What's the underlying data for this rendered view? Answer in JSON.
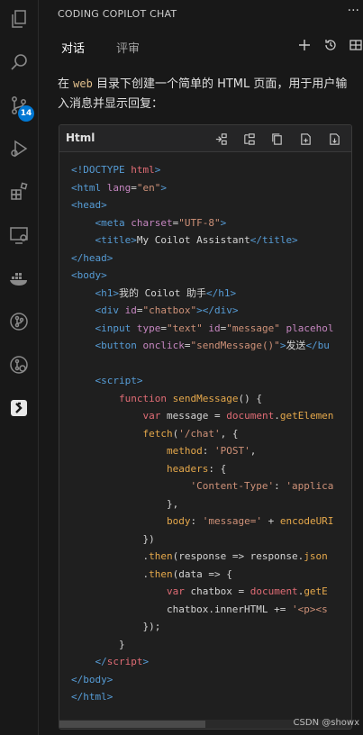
{
  "panel": {
    "title": "CODING COPILOT CHAT",
    "more": "···",
    "tabs": [
      {
        "label": "对话"
      },
      {
        "label": "评审"
      }
    ]
  },
  "activity": {
    "source_control_badge": "14"
  },
  "prompt": {
    "before": "在 ",
    "keyword": "web",
    "after": " 目录下创建一个简单的 HTML 页面，用于用户输入消息并显示回复："
  },
  "code_block": {
    "language": "Html",
    "lines": [
      [
        [
          "t-tag",
          "<!DOCTYPE "
        ],
        [
          "t-tagname",
          "html"
        ],
        [
          "t-tag",
          ">"
        ]
      ],
      [
        [
          "t-tag",
          "<html "
        ],
        [
          "t-attr",
          "lang"
        ],
        [
          "t-plain",
          "="
        ],
        [
          "t-str",
          "\"en\""
        ],
        [
          "t-tag",
          ">"
        ]
      ],
      [
        [
          "t-tag",
          "<head>"
        ]
      ],
      [
        [
          "t-plain",
          "    "
        ],
        [
          "t-tag",
          "<meta "
        ],
        [
          "t-attr",
          "charset"
        ],
        [
          "t-plain",
          "="
        ],
        [
          "t-str",
          "\"UTF-8\""
        ],
        [
          "t-tag",
          ">"
        ]
      ],
      [
        [
          "t-plain",
          "    "
        ],
        [
          "t-tag",
          "<title>"
        ],
        [
          "t-text",
          "My Coilot Assistant"
        ],
        [
          "t-tag",
          "</title>"
        ]
      ],
      [
        [
          "t-tag",
          "</head>"
        ]
      ],
      [
        [
          "t-tag",
          "<body>"
        ]
      ],
      [
        [
          "t-plain",
          "    "
        ],
        [
          "t-tag",
          "<h1>"
        ],
        [
          "t-text",
          "我的 Coilot 助手"
        ],
        [
          "t-tag",
          "</h1>"
        ]
      ],
      [
        [
          "t-plain",
          "    "
        ],
        [
          "t-tag",
          "<div "
        ],
        [
          "t-attr",
          "id"
        ],
        [
          "t-plain",
          "="
        ],
        [
          "t-str",
          "\"chatbox\""
        ],
        [
          "t-tag",
          "></div>"
        ]
      ],
      [
        [
          "t-plain",
          "    "
        ],
        [
          "t-tag",
          "<input "
        ],
        [
          "t-attr",
          "type"
        ],
        [
          "t-plain",
          "="
        ],
        [
          "t-str",
          "\"text\""
        ],
        [
          "t-plain",
          " "
        ],
        [
          "t-attr",
          "id"
        ],
        [
          "t-plain",
          "="
        ],
        [
          "t-str",
          "\"message\""
        ],
        [
          "t-plain",
          " "
        ],
        [
          "t-attr",
          "placehol"
        ]
      ],
      [
        [
          "t-plain",
          "    "
        ],
        [
          "t-tag",
          "<button "
        ],
        [
          "t-attr",
          "onclick"
        ],
        [
          "t-plain",
          "="
        ],
        [
          "t-str",
          "\"sendMessage()\""
        ],
        [
          "t-tag",
          ">"
        ],
        [
          "t-text",
          "发送"
        ],
        [
          "t-tag",
          "</bu"
        ]
      ],
      [
        [
          "t-plain",
          ""
        ]
      ],
      [
        [
          "t-plain",
          "    "
        ],
        [
          "t-tag",
          "<script>"
        ]
      ],
      [
        [
          "t-plain",
          "        "
        ],
        [
          "t-kw",
          "function "
        ],
        [
          "t-fn",
          "sendMessage"
        ],
        [
          "t-plain",
          "() {"
        ]
      ],
      [
        [
          "t-plain",
          "            "
        ],
        [
          "t-kw",
          "var "
        ],
        [
          "t-plain",
          "message = "
        ],
        [
          "t-obj",
          "document"
        ],
        [
          "t-plain",
          "."
        ],
        [
          "t-prop",
          "getElemen"
        ]
      ],
      [
        [
          "t-plain",
          "            "
        ],
        [
          "t-fn",
          "fetch"
        ],
        [
          "t-plain",
          "("
        ],
        [
          "t-str",
          "'/chat'"
        ],
        [
          "t-plain",
          ", {"
        ]
      ],
      [
        [
          "t-plain",
          "                "
        ],
        [
          "t-prop",
          "method"
        ],
        [
          "t-plain",
          ": "
        ],
        [
          "t-str",
          "'POST'"
        ],
        [
          "t-plain",
          ","
        ]
      ],
      [
        [
          "t-plain",
          "                "
        ],
        [
          "t-prop",
          "headers"
        ],
        [
          "t-plain",
          ": {"
        ]
      ],
      [
        [
          "t-plain",
          "                    "
        ],
        [
          "t-str",
          "'Content-Type'"
        ],
        [
          "t-plain",
          ": "
        ],
        [
          "t-str",
          "'applica"
        ]
      ],
      [
        [
          "t-plain",
          "                },"
        ]
      ],
      [
        [
          "t-plain",
          "                "
        ],
        [
          "t-prop",
          "body"
        ],
        [
          "t-plain",
          ": "
        ],
        [
          "t-str",
          "'message='"
        ],
        [
          "t-plain",
          " + "
        ],
        [
          "t-fn",
          "encodeURI"
        ]
      ],
      [
        [
          "t-plain",
          "            })"
        ]
      ],
      [
        [
          "t-plain",
          "            ."
        ],
        [
          "t-fn",
          "then"
        ],
        [
          "t-plain",
          "(response => response."
        ],
        [
          "t-fn",
          "json"
        ]
      ],
      [
        [
          "t-plain",
          "            ."
        ],
        [
          "t-fn",
          "then"
        ],
        [
          "t-plain",
          "(data => {"
        ]
      ],
      [
        [
          "t-plain",
          "                "
        ],
        [
          "t-kw",
          "var "
        ],
        [
          "t-plain",
          "chatbox = "
        ],
        [
          "t-obj",
          "document"
        ],
        [
          "t-plain",
          "."
        ],
        [
          "t-prop",
          "getE"
        ]
      ],
      [
        [
          "t-plain",
          "                chatbox.innerHTML += "
        ],
        [
          "t-str",
          "'<p><s"
        ]
      ],
      [
        [
          "t-plain",
          "            });"
        ]
      ],
      [
        [
          "t-plain",
          "        }"
        ]
      ],
      [
        [
          "t-plain",
          "    "
        ],
        [
          "t-tag",
          "</"
        ],
        [
          "t-tagname",
          "script"
        ],
        [
          "t-tag",
          ">"
        ]
      ],
      [
        [
          "t-tag",
          "</body>"
        ]
      ],
      [
        [
          "t-tag",
          "</html>"
        ]
      ]
    ]
  },
  "watermark": "CSDN @showx"
}
